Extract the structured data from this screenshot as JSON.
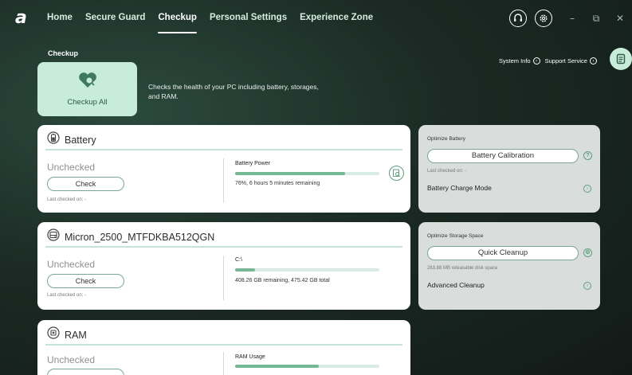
{
  "app": {
    "logo": "a"
  },
  "nav": [
    {
      "label": "Home"
    },
    {
      "label": "Secure Guard"
    },
    {
      "label": "Checkup",
      "active": true
    },
    {
      "label": "Personal Settings"
    },
    {
      "label": "Experience Zone"
    }
  ],
  "window_controls": {
    "minimize": "–",
    "restore": "⧉",
    "close": "✕"
  },
  "checkup": {
    "title": "Checkup",
    "button_label": "Checkup All",
    "description": "Checks the health of your PC including battery, storages, and RAM.",
    "links": {
      "system_info": "System Info",
      "support_service": "Support Service"
    }
  },
  "battery": {
    "title": "Battery",
    "status": "Unchecked",
    "check_label": "Check",
    "last_checked": "Last checked on: -",
    "metric_label": "Battery Power",
    "level": 0.76,
    "detail": "76%, 6 hours 5 minutes remaining"
  },
  "storage": {
    "title": "Micron_2500_MTFDKBA512QGN",
    "status": "Unchecked",
    "check_label": "Check",
    "last_checked": "Last checked on: -",
    "metric_label": "C:\\",
    "level": 0.14,
    "detail": "408.26 GB remaining, 475.42 GB total"
  },
  "ram": {
    "title": "RAM",
    "status": "Unchecked",
    "metric_label": "RAM Usage",
    "level": 0.58
  },
  "optimize_battery": {
    "title": "Optimize Battery",
    "button_label": "Battery Calibration",
    "last_checked": "Last checked on: -",
    "link_label": "Battery Charge Mode"
  },
  "optimize_storage": {
    "title": "Optimize Storage Space",
    "button_label": "Quick Cleanup",
    "sub": "263.88 MB releasable disk space",
    "link_label": "Advanced Cleanup"
  },
  "colors": {
    "accent": "#74b896",
    "mint": "#c7ecd9",
    "panel": "#d9dedc"
  }
}
